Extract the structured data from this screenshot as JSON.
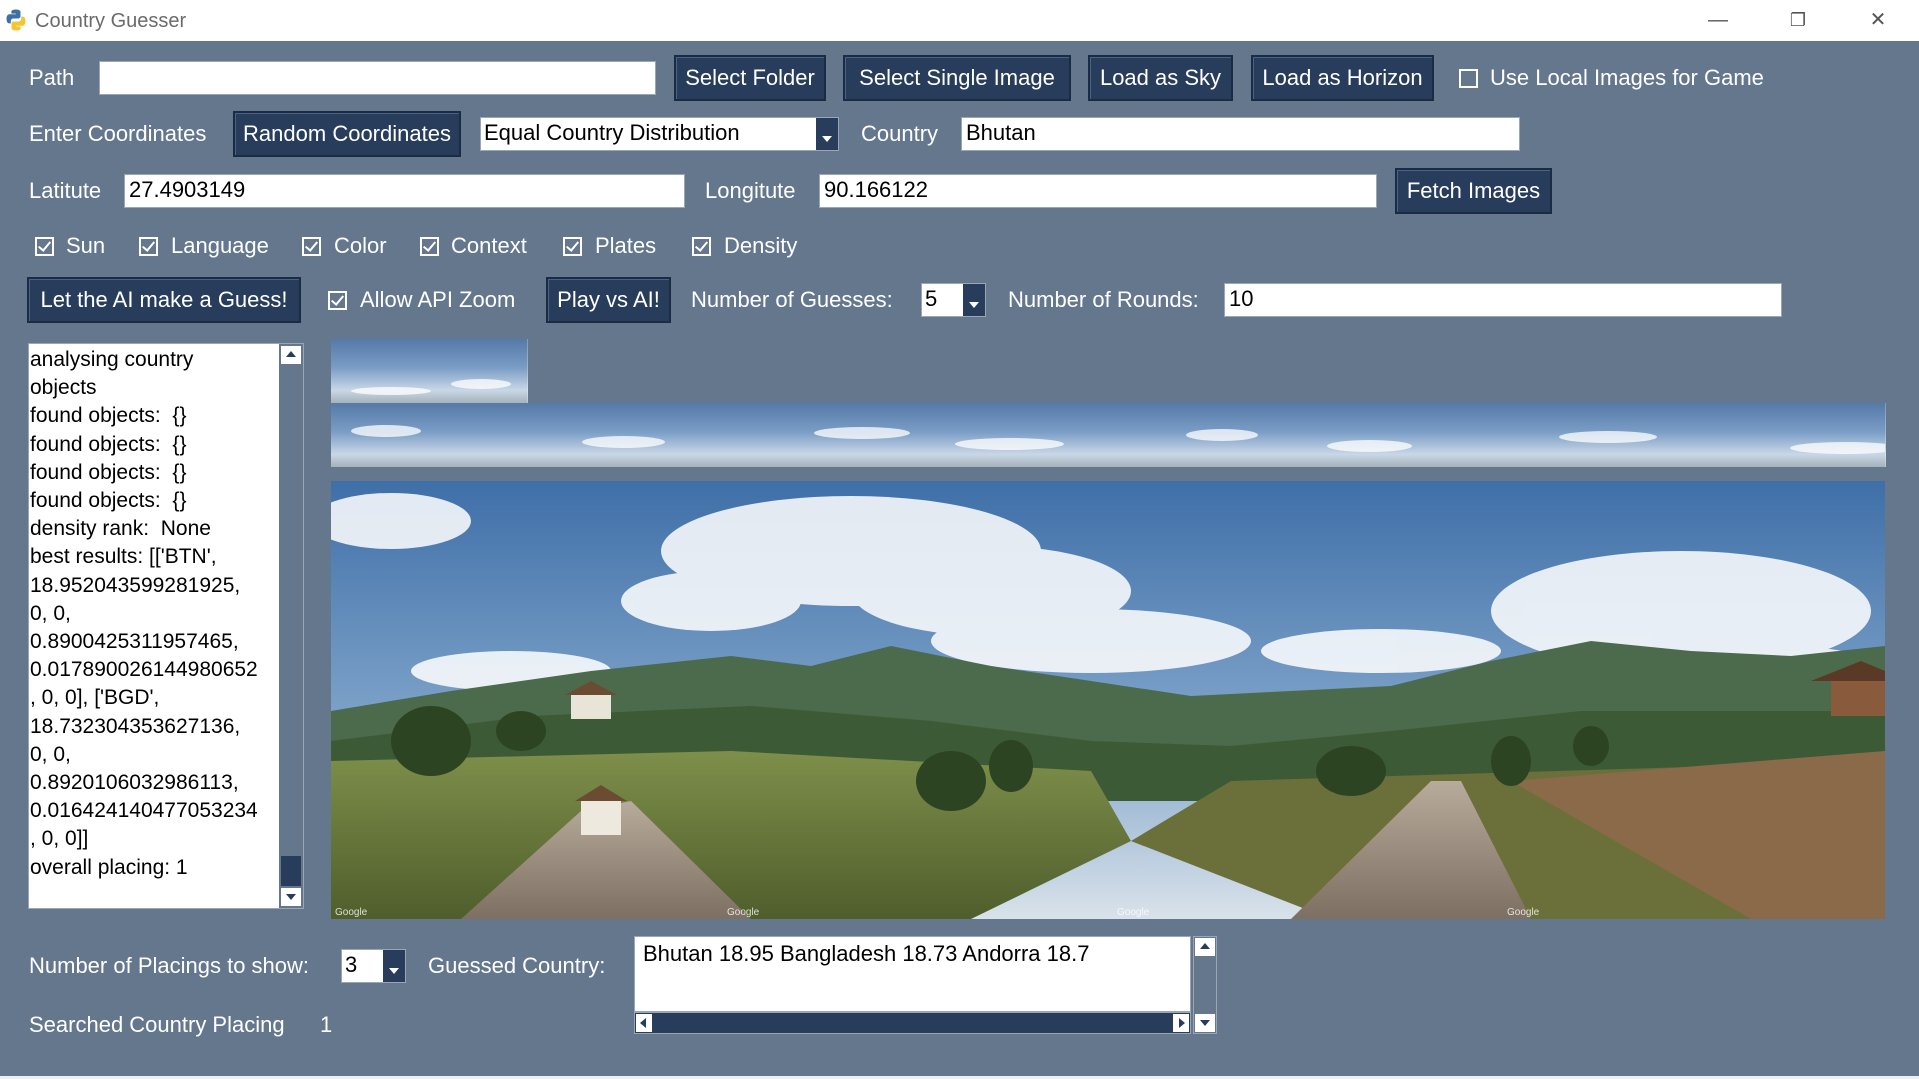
{
  "window": {
    "title": "Country Guesser",
    "minimize_glyph": "—",
    "restore_glyph": "❐",
    "close_glyph": "✕"
  },
  "row1": {
    "path_label": "Path",
    "path_value": "",
    "select_folder": "Select Folder",
    "select_single_image": "Select Single Image",
    "load_as_sky": "Load as Sky",
    "load_as_horizon": "Load as Horizon",
    "use_local_images_label": "Use Local Images for Game",
    "use_local_images_checked": false
  },
  "row2": {
    "enter_coordinates_label": "Enter Coordinates",
    "random_coordinates": "Random Coordinates",
    "distribution_value": "Equal Country Distribution",
    "country_label": "Country",
    "country_value": "Bhutan"
  },
  "row3": {
    "latitude_label": "Latitute",
    "latitude_value": "27.4903149",
    "longitude_label": "Longitute",
    "longitude_value": "90.166122",
    "fetch_images": "Fetch Images"
  },
  "features": [
    {
      "label": "Sun",
      "checked": true
    },
    {
      "label": "Language",
      "checked": true
    },
    {
      "label": "Color",
      "checked": true
    },
    {
      "label": "Context",
      "checked": true
    },
    {
      "label": "Plates",
      "checked": true
    },
    {
      "label": "Density",
      "checked": true
    }
  ],
  "row5": {
    "ai_guess": "Let the AI make a Guess!",
    "allow_api_zoom_label": "Allow API Zoom",
    "allow_api_zoom_checked": true,
    "play_vs_ai": "Play vs AI!",
    "number_of_guesses_label": "Number of Guesses:",
    "number_of_guesses_value": "5",
    "number_of_rounds_label": "Number of Rounds:",
    "number_of_rounds_value": "10"
  },
  "log": {
    "text": "analysing country\nobjects\nfound objects:  {}\nfound objects:  {}\nfound objects:  {}\nfound objects:  {}\ndensity rank:  None\nbest results: [['BTN',\n18.952043599281925,\n0, 0,\n0.8900425311957465,\n0.017890026144980652\n, 0, 0], ['BGD',\n18.732304353627136,\n0, 0,\n0.8920106032986113,\n0.016424140477053234\n, 0, 0]]\noverall placing: 1"
  },
  "bottom": {
    "placings_label": "Number of Placings to show:",
    "placings_value": "3",
    "guessed_country_label": "Guessed Country:",
    "guessed_country_value": "Bhutan 18.95 Bangladesh 18.73 Andorra 18.7",
    "searched_placing_label": "Searched Country Placing",
    "searched_placing_value": "1"
  },
  "images": {
    "watermark": "Google",
    "sky_tile_count": 8
  },
  "colors": {
    "background": "#64778d",
    "button": "#283d5b",
    "text": "#ffffff"
  }
}
